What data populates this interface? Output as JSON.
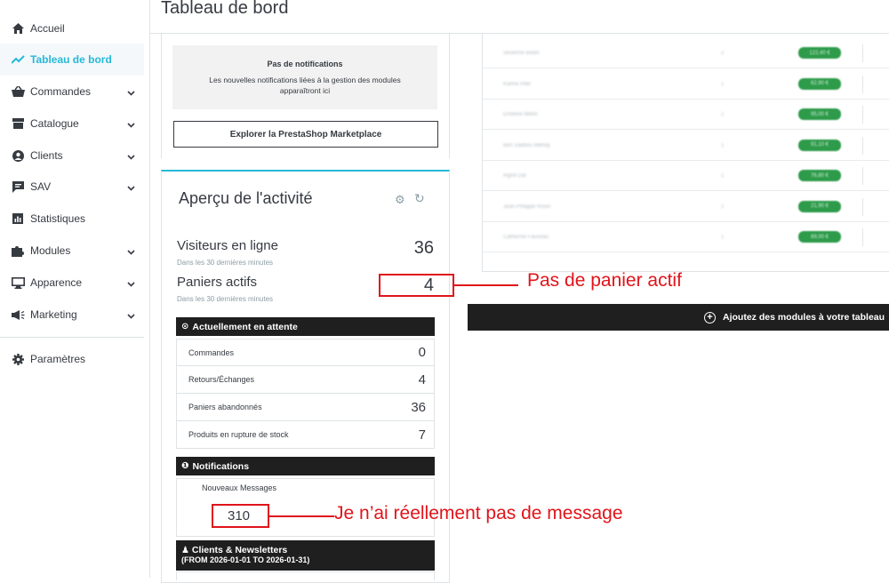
{
  "page_title": "Tableau de bord",
  "sidebar": {
    "items": [
      {
        "label": "Accueil",
        "icon": "home-icon",
        "has_chevron": false,
        "active": false
      },
      {
        "label": "Tableau de bord",
        "icon": "trending-up-icon",
        "has_chevron": false,
        "active": true
      },
      {
        "label": "Commandes",
        "icon": "shopping-basket-icon",
        "has_chevron": true,
        "active": false
      },
      {
        "label": "Catalogue",
        "icon": "store-icon",
        "has_chevron": true,
        "active": false
      },
      {
        "label": "Clients",
        "icon": "user-circle-icon",
        "has_chevron": true,
        "active": false
      },
      {
        "label": "SAV",
        "icon": "chat-icon",
        "has_chevron": true,
        "active": false
      },
      {
        "label": "Statistiques",
        "icon": "bar-chart-icon",
        "has_chevron": false,
        "active": false
      },
      {
        "label": "Modules",
        "icon": "puzzle-icon",
        "has_chevron": true,
        "active": false
      },
      {
        "label": "Apparence",
        "icon": "monitor-icon",
        "has_chevron": true,
        "active": false
      },
      {
        "label": "Marketing",
        "icon": "megaphone-icon",
        "has_chevron": true,
        "active": false
      },
      {
        "label": "Paramètres",
        "icon": "gear-icon",
        "has_chevron": false,
        "active": false
      }
    ]
  },
  "notifications_panel": {
    "title": "Pas de notifications",
    "description": "Les nouvelles notifications liées à la gestion des modules apparaîtront ici",
    "marketplace_button": "Explorer la PrestaShop Marketplace"
  },
  "activity": {
    "title": "Aperçu de l'activité",
    "visitors_label": "Visiteurs en ligne",
    "visitors_sub": "Dans les 30 dernières minutes",
    "visitors_value": "36",
    "carts_label": "Paniers actifs",
    "carts_sub": "Dans les 30 dernières minutes",
    "carts_value": "4",
    "pending_header": "Actuellement en attente",
    "pending_rows": [
      {
        "label": "Commandes",
        "value": "0"
      },
      {
        "label": "Retours/Échanges",
        "value": "4"
      },
      {
        "label": "Paniers abandonnés",
        "value": "36"
      },
      {
        "label": "Produits en rupture de stock",
        "value": "7"
      }
    ],
    "notifications_header": "Notifications",
    "new_messages_label": "Nouveaux Messages",
    "new_messages_value": "310",
    "clients_header": "Clients & Newsletters",
    "clients_range": "(FROM 2026-01-01 TO 2026-01-31)"
  },
  "right_table": {
    "rows": [
      {
        "name": "Severine Bodin",
        "qty": "2",
        "amount": "122,40 €"
      },
      {
        "name": "Karine Pitel",
        "qty": "1",
        "amount": "62,90 €"
      },
      {
        "name": "Emeline Millon",
        "qty": "2",
        "amount": "95,00 €"
      },
      {
        "name": "Ben Saddou Mehdy",
        "qty": "1",
        "amount": "91,10 €"
      },
      {
        "name": "Ingrid Dal",
        "qty": "1",
        "amount": "76,80 €"
      },
      {
        "name": "Jean-Philippe Rosin",
        "qty": "1",
        "amount": "21,90 €"
      },
      {
        "name": "Catherine Fauveau",
        "qty": "1",
        "amount": "89,00 €"
      }
    ]
  },
  "add_modules_label": "Ajoutez des modules à votre tableau",
  "annotations": {
    "carts": "Pas de panier actif",
    "messages": "Je n’ai réellement pas de message"
  },
  "colors": {
    "accent": "#25b9d7",
    "annotation": "#e0141a",
    "dark_header": "#1f1f1f",
    "badge_green": "#2d9b4a"
  }
}
